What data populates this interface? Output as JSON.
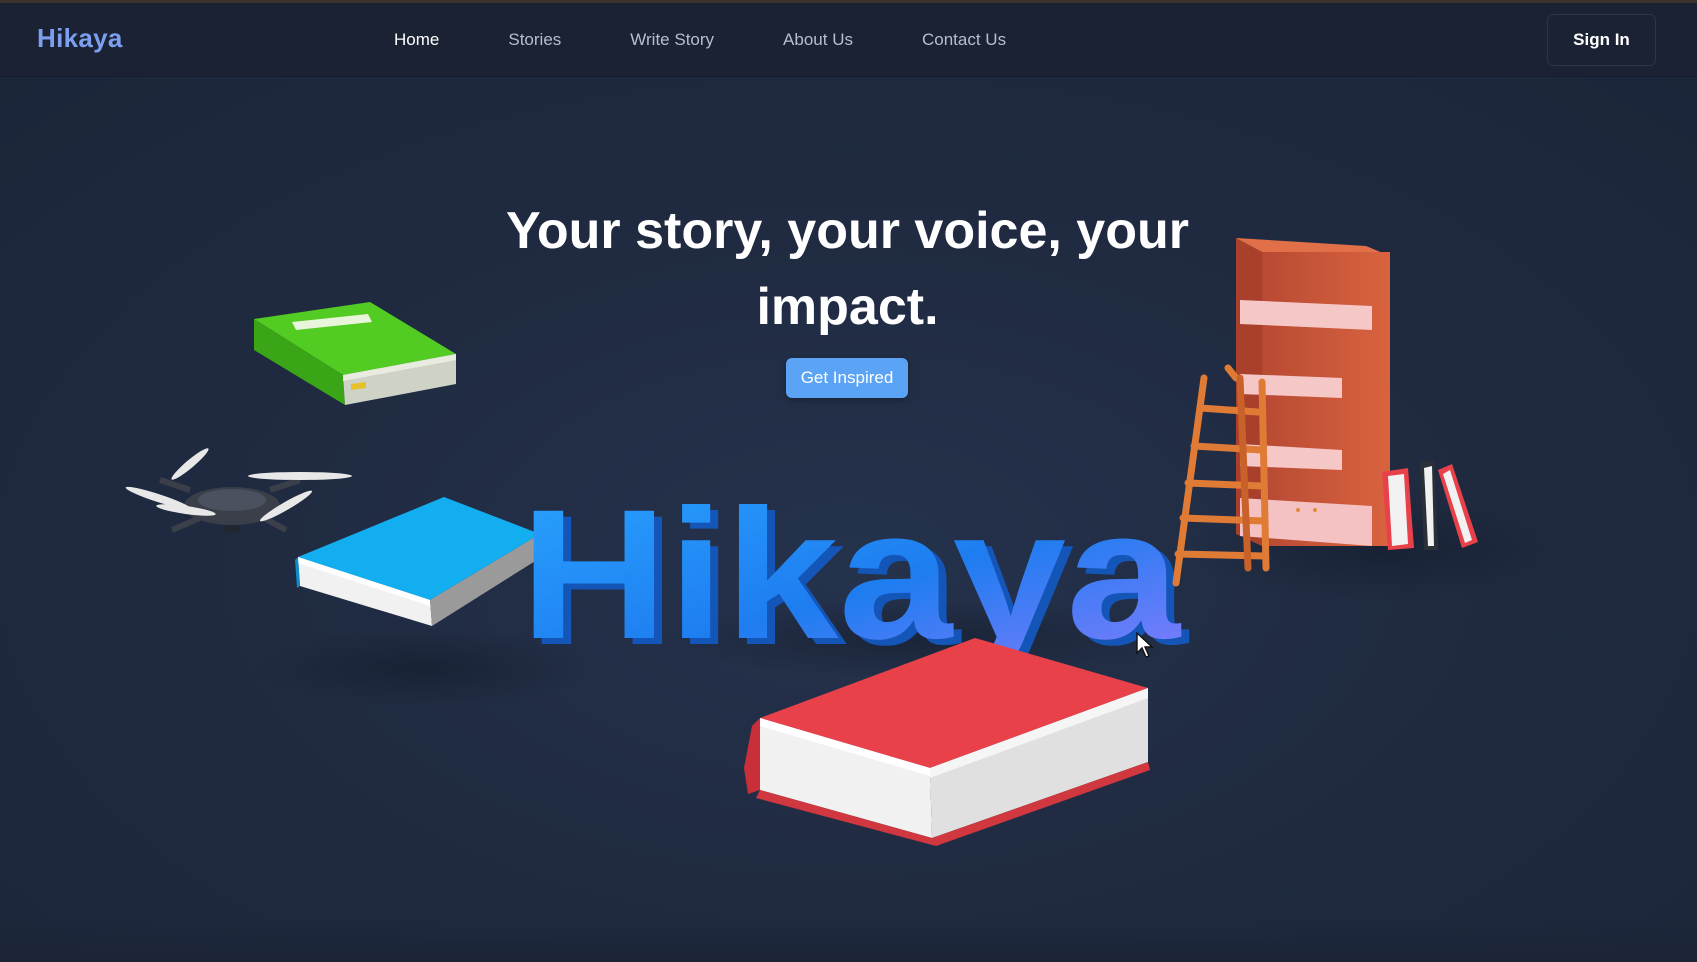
{
  "brand": {
    "name": "Hikaya"
  },
  "nav": {
    "links": [
      {
        "label": "Home",
        "active": true
      },
      {
        "label": "Stories",
        "active": false
      },
      {
        "label": "Write Story",
        "active": false
      },
      {
        "label": "About Us",
        "active": false
      },
      {
        "label": "Contact Us",
        "active": false
      }
    ],
    "sign_in_label": "Sign In"
  },
  "hero": {
    "headline_line1": "Your story, your voice, your",
    "headline_line2": "impact.",
    "cta_label": "Get Inspired",
    "scene_word": "Hikaya"
  },
  "colors": {
    "background": "#1f2a40",
    "navbar": "#1a2233",
    "brand": "#7c9ff0",
    "cta": "#5aa3f5",
    "book_green": "#45c21c",
    "book_blue": "#12aef0",
    "book_red": "#e8414a",
    "shelf": "#c9573a",
    "ladder": "#e07b35",
    "letters": "#1f8fff"
  },
  "icons": {
    "drone": "drone-icon",
    "cursor": "mouse-cursor-icon"
  }
}
